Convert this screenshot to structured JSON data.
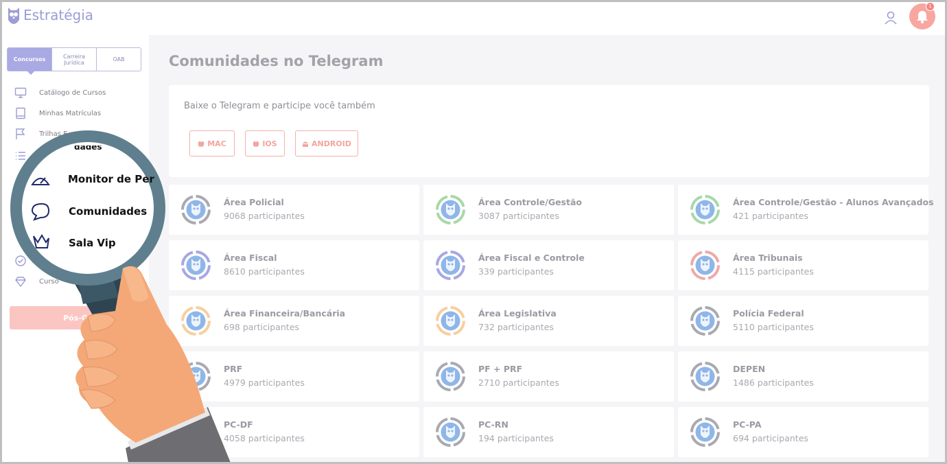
{
  "header": {
    "logo_text": "Estratégia",
    "notification_count": "1",
    "colors": {
      "brand": "#9c9cd6",
      "bell": "#f7a7a0"
    }
  },
  "sidebar": {
    "segments": [
      {
        "label": "Concursos",
        "active": true
      },
      {
        "label": "Carreira Jurídica",
        "active": false
      },
      {
        "label": "OAB",
        "active": false
      }
    ],
    "items": [
      {
        "label": "Catálogo de Cursos",
        "icon": "monitor-icon"
      },
      {
        "label": "Minhas Matrículas",
        "icon": "book-icon"
      },
      {
        "label": "Trilhas E",
        "icon": "flag-icon"
      },
      {
        "label": "",
        "icon": "list-icon"
      },
      {
        "label": "",
        "icon": "check-circle-icon"
      },
      {
        "label": "Curso",
        "icon": "diamond-icon"
      }
    ],
    "pos_button": "Pós-G"
  },
  "magnifier": {
    "items": [
      {
        "label": "Monitor de Per",
        "icon": "speedometer-icon"
      },
      {
        "label": "Comunidades",
        "icon": "chat-bubble-icon"
      },
      {
        "label": "Sala Vip",
        "icon": "crown-icon"
      }
    ],
    "partial_top": "dades"
  },
  "main": {
    "title": "Comunidades no Telegram",
    "download": {
      "text": "Baixe o Telegram e participe você também",
      "buttons": [
        "MAC",
        "IOS",
        "ANDROID"
      ]
    },
    "groups": [
      {
        "name": "Área Policial",
        "count": "9068 participantes",
        "color": "#a9a9b2"
      },
      {
        "name": "Área Controle/Gestão",
        "count": "3087 participantes",
        "color": "#a8d8a8"
      },
      {
        "name": "Área Controle/Gestão - Alunos Avançados",
        "count": "421 participantes",
        "color": "#a8d8a8"
      },
      {
        "name": "Área Fiscal",
        "count": "8610 participantes",
        "color": "#a7a7e6"
      },
      {
        "name": "Área Fiscal e Controle",
        "count": "339 participantes",
        "color": "#a7a7e6"
      },
      {
        "name": "Área Tribunais",
        "count": "4115 participantes",
        "color": "#f0a8a8"
      },
      {
        "name": "Área Financeira/Bancária",
        "count": "698 participantes",
        "color": "#f7cf9e"
      },
      {
        "name": "Área Legislativa",
        "count": "732 participantes",
        "color": "#f7cf9e"
      },
      {
        "name": "Polícia Federal",
        "count": "5110 participantes",
        "color": "#a9a9b2"
      },
      {
        "name": "PRF",
        "count": "4979 participantes",
        "color": "#a9a9b2"
      },
      {
        "name": "PF + PRF",
        "count": "2710 participantes",
        "color": "#a9a9b2"
      },
      {
        "name": "DEPEN",
        "count": "1486 participantes",
        "color": "#a9a9b2"
      },
      {
        "name": "PC-DF",
        "count": "4058 participantes",
        "color": "#a9a9b2"
      },
      {
        "name": "PC-RN",
        "count": "194 participantes",
        "color": "#a9a9b2"
      },
      {
        "name": "PC-PA",
        "count": "694 participantes",
        "color": "#a9a9b2"
      }
    ]
  }
}
